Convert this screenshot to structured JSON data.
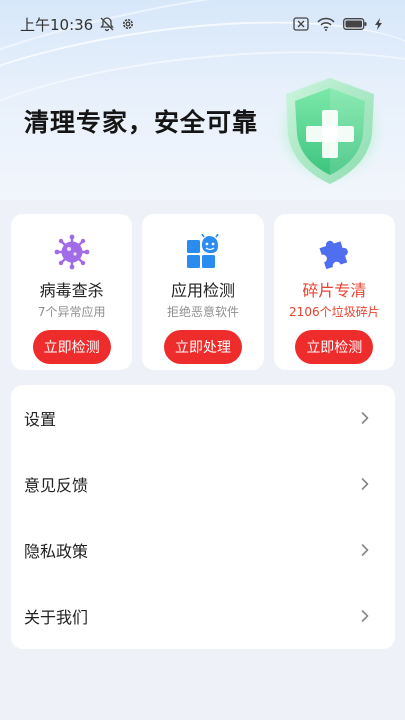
{
  "status_bar": {
    "time": "上午10:36",
    "icons": [
      "mute-bell-icon",
      "settings-gear-icon",
      "sim-blocked-icon",
      "wifi-icon",
      "battery-icon",
      "charging-icon"
    ]
  },
  "hero": {
    "title": "清理专家，安全可靠",
    "shield_icon": "shield-plus-icon"
  },
  "cards": [
    {
      "icon": "virus-icon",
      "title": "病毒查杀",
      "subtitle": "7个异常应用",
      "button": "立即检测",
      "icon_color": "#a26be8"
    },
    {
      "icon": "app-grid-icon",
      "title": "应用检测",
      "subtitle": "拒绝恶意软件",
      "button": "立即处理",
      "icon_color": "#2b8cf0"
    },
    {
      "icon": "puzzle-icon",
      "title": "碎片专清",
      "subtitle": "2106个垃圾碎片",
      "button": "立即检测",
      "icon_color": "#4f6ef0"
    }
  ],
  "menu": {
    "items": [
      {
        "label": "设置"
      },
      {
        "label": "意见反馈"
      },
      {
        "label": "隐私政策"
      },
      {
        "label": "关于我们"
      }
    ]
  },
  "colors": {
    "accent_red": "#ee2c2c",
    "highlight_red": "#e8432f",
    "background": "#eef1f7"
  }
}
